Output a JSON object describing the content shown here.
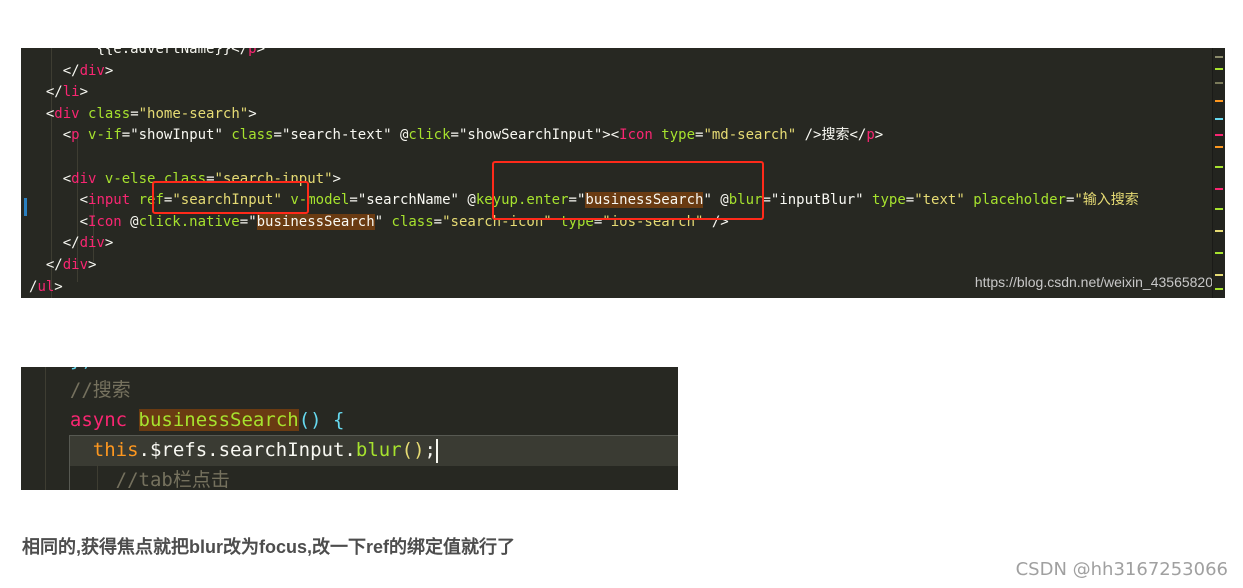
{
  "code_screenshot_1": {
    "lines": [
      {
        "indent": "        ",
        "parts": [
          [
            "plain",
            "{{e.advertName}}"
          ],
          [
            "punc",
            "</"
          ],
          [
            "tag",
            "p"
          ],
          [
            "punc",
            ">"
          ]
        ]
      },
      {
        "indent": "    ",
        "parts": [
          [
            "punc",
            "</"
          ],
          [
            "tag",
            "div"
          ],
          [
            "punc",
            ">"
          ]
        ]
      },
      {
        "indent": "  ",
        "parts": [
          [
            "punc",
            "</"
          ],
          [
            "tag",
            "li"
          ],
          [
            "punc",
            ">"
          ]
        ]
      },
      {
        "indent": "  ",
        "parts": [
          [
            "punc",
            "<"
          ],
          [
            "tag",
            "div"
          ],
          [
            "plain",
            " "
          ],
          [
            "attr",
            "class"
          ],
          [
            "punc",
            "="
          ],
          [
            "str",
            "\"home-search\""
          ],
          [
            "punc",
            ">"
          ]
        ]
      },
      {
        "indent": "    ",
        "parts": [
          [
            "punc",
            "<"
          ],
          [
            "tag",
            "p"
          ],
          [
            "plain",
            " "
          ],
          [
            "attr",
            "v-if"
          ],
          [
            "punc",
            "="
          ],
          [
            "plain",
            "\"showInput\""
          ],
          [
            "plain",
            " "
          ],
          [
            "attr",
            "class"
          ],
          [
            "punc",
            "="
          ],
          [
            "plain",
            "\"search-text\""
          ],
          [
            "plain",
            " @"
          ],
          [
            "attr",
            "click"
          ],
          [
            "punc",
            "="
          ],
          [
            "plain",
            "\"showSearchInput\""
          ],
          [
            "punc",
            ">"
          ],
          [
            "punc",
            "<"
          ],
          [
            "tag",
            "Icon"
          ],
          [
            "plain",
            " "
          ],
          [
            "attr",
            "type"
          ],
          [
            "punc",
            "="
          ],
          [
            "str",
            "\"md-search\""
          ],
          [
            "plain",
            " />搜索"
          ],
          [
            "punc",
            "</"
          ],
          [
            "tag",
            "p"
          ],
          [
            "punc",
            ">"
          ]
        ]
      },
      {
        "indent": "",
        "parts": []
      },
      {
        "indent": "    ",
        "parts": [
          [
            "punc",
            "<"
          ],
          [
            "tag",
            "div"
          ],
          [
            "plain",
            " "
          ],
          [
            "attr",
            "v-else"
          ],
          [
            "plain",
            " "
          ],
          [
            "attr",
            "class"
          ],
          [
            "punc",
            "="
          ],
          [
            "str",
            "\"search-input\""
          ],
          [
            "punc",
            ">"
          ]
        ]
      },
      {
        "indent": "      ",
        "parts": [
          [
            "punc",
            "<"
          ],
          [
            "tag",
            "input"
          ],
          [
            "plain",
            " "
          ],
          [
            "attr",
            "ref"
          ],
          [
            "punc",
            "="
          ],
          [
            "str",
            "\"searchInput\""
          ],
          [
            "plain",
            " "
          ],
          [
            "attr",
            "v-model"
          ],
          [
            "punc",
            "="
          ],
          [
            "plain",
            "\"searchName\""
          ],
          [
            "plain",
            " @"
          ],
          [
            "attr",
            "keyup.enter"
          ],
          [
            "punc",
            "="
          ],
          [
            "plain",
            "\""
          ],
          [
            "hl",
            "businessSearch"
          ],
          [
            "plain",
            "\""
          ],
          [
            "plain",
            " @"
          ],
          [
            "attr",
            "blur"
          ],
          [
            "punc",
            "="
          ],
          [
            "plain",
            "\"inputBlur\""
          ],
          [
            "plain",
            " "
          ],
          [
            "attr",
            "type"
          ],
          [
            "punc",
            "="
          ],
          [
            "str",
            "\"text\""
          ],
          [
            "plain",
            " "
          ],
          [
            "attr",
            "placeholder"
          ],
          [
            "punc",
            "="
          ],
          [
            "str",
            "\"输入搜索"
          ]
        ]
      },
      {
        "indent": "      ",
        "parts": [
          [
            "punc",
            "<"
          ],
          [
            "tag",
            "Icon"
          ],
          [
            "plain",
            " @"
          ],
          [
            "attr",
            "click.native"
          ],
          [
            "punc",
            "="
          ],
          [
            "plain",
            "\""
          ],
          [
            "hl",
            "businessSearch"
          ],
          [
            "plain",
            "\""
          ],
          [
            "plain",
            " "
          ],
          [
            "attr",
            "class"
          ],
          [
            "punc",
            "="
          ],
          [
            "str",
            "\"search-icon\""
          ],
          [
            "plain",
            " "
          ],
          [
            "attr",
            "type"
          ],
          [
            "punc",
            "="
          ],
          [
            "str",
            "\"ios-search\""
          ],
          [
            "plain",
            " />"
          ]
        ]
      },
      {
        "indent": "    ",
        "parts": [
          [
            "punc",
            "</"
          ],
          [
            "tag",
            "div"
          ],
          [
            "punc",
            ">"
          ]
        ]
      },
      {
        "indent": "  ",
        "parts": [
          [
            "punc",
            "</"
          ],
          [
            "tag",
            "div"
          ],
          [
            "punc",
            ">"
          ]
        ]
      },
      {
        "indent": "",
        "parts": [
          [
            "plain",
            "/"
          ],
          [
            "tag",
            "ul"
          ],
          [
            "punc",
            ">"
          ]
        ]
      }
    ],
    "watermark": "https://blog.csdn.net/weixin_43565820"
  },
  "code_screenshot_2": {
    "lines": [
      {
        "indent": "  ",
        "parts": [
          [
            "brace",
            "})"
          ]
        ]
      },
      {
        "indent": "  ",
        "parts": [
          [
            "cmt",
            "//搜索"
          ]
        ]
      },
      {
        "indent": "  ",
        "parts": [
          [
            "kw",
            "async"
          ],
          [
            "plain",
            " "
          ],
          [
            "hlfn",
            "businessSearch"
          ],
          [
            "brace",
            "() {"
          ]
        ]
      },
      {
        "indent": "    ",
        "parts": [
          [
            "this",
            "this"
          ],
          [
            "plain",
            ".$refs.searchInput."
          ],
          [
            "fn",
            "blur"
          ],
          [
            "paren",
            "()"
          ],
          [
            "plain",
            ";"
          ]
        ]
      },
      {
        "indent": "      ",
        "parts": [
          [
            "cmt",
            "//tab栏点击"
          ]
        ]
      }
    ]
  },
  "caption": "相同的,获得焦点就把blur改为focus,改一下ref的绑定值就行了",
  "csdn_watermark": "CSDN @hh3167253066",
  "colors": {
    "editor_bg": "#272822",
    "highlight_box": "#ff2a1a",
    "tag": "#f92672",
    "attr": "#a6e22e",
    "string": "#e6db74",
    "word_highlight": "#6a3b12"
  }
}
